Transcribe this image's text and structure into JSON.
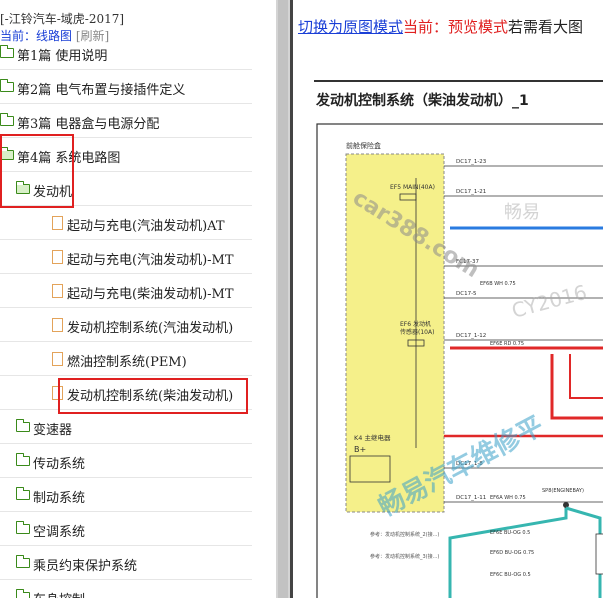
{
  "breadcrumb": {
    "path": "[-江铃汽车-域虎-2017]",
    "current_label": "当前：线路图",
    "refresh": "[刷新]"
  },
  "tree": {
    "items": [
      {
        "label": "第1篇 使用说明",
        "type": "folder",
        "level": 0
      },
      {
        "label": "第2篇 电气布置与接插件定义",
        "type": "folder",
        "level": 0
      },
      {
        "label": "第3篇 电器盒与电源分配",
        "type": "folder",
        "level": 0
      },
      {
        "label": "第4篇 系统电路图",
        "type": "folder",
        "level": 0,
        "open": true
      },
      {
        "label": "发动机",
        "type": "folder",
        "level": 1,
        "open": true
      },
      {
        "label": "起动与充电(汽油发动机)AT",
        "type": "doc",
        "level": 2
      },
      {
        "label": "起动与充电(汽油发动机)-MT",
        "type": "doc",
        "level": 2
      },
      {
        "label": "起动与充电(柴油发动机)-MT",
        "type": "doc",
        "level": 2
      },
      {
        "label": "发动机控制系统(汽油发动机)",
        "type": "doc",
        "level": 2
      },
      {
        "label": "燃油控制系统(PEM)",
        "type": "doc",
        "level": 2
      },
      {
        "label": "发动机控制系统(柴油发动机)",
        "type": "doc",
        "level": 2,
        "selected": true
      },
      {
        "label": "变速器",
        "type": "folder",
        "level": 1
      },
      {
        "label": "传动系统",
        "type": "folder",
        "level": 1
      },
      {
        "label": "制动系统",
        "type": "folder",
        "level": 1
      },
      {
        "label": "空调系统",
        "type": "folder",
        "level": 1
      },
      {
        "label": "乘员约束保护系统",
        "type": "folder",
        "level": 1
      },
      {
        "label": "车身控制",
        "type": "folder",
        "level": 1
      }
    ]
  },
  "preview": {
    "switch_link": "切换为原图模式",
    "mode_label": "当前：预览模式",
    "hint": "若需看大图",
    "diagram_title": "发动机控制系统（柴油发动机）_1",
    "diagram": {
      "box_label": "前舱保险盒",
      "fuse_ef5": "EF5 MAIN(40A)",
      "fuse_ef6": "EF6 发动机",
      "fuse_ef6_sub": "传感器(10A)",
      "relay": "K4 主继电器",
      "b_plus": "B+",
      "wires": [
        "DC17_1-23",
        "DC17_1-21",
        "FC17-37",
        "DC17-5",
        "DC17_1-12",
        "EF6E RD 0.75",
        "EF6B WH 0.75",
        "EF6A WH 0.75",
        "DC17_1-8",
        "DC17_1-11",
        "SP8(ENGINEBAY)",
        "EF6E BU-OG 0.5",
        "EF6D BU-OG 0.75",
        "EF6C BU-OG 0.5"
      ],
      "notes": [
        "参考：发动机控制系统_2(接...)",
        "参考：发动机控制系统_3(接...)"
      ]
    },
    "watermarks": [
      "car388.com",
      "畅易汽车维修平",
      "畅易",
      "CY2016"
    ]
  },
  "colors": {
    "selected_box": "#e02020",
    "link": "#1a3fd6",
    "folder": "#3a8a1a",
    "doc": "#e3a35a"
  }
}
